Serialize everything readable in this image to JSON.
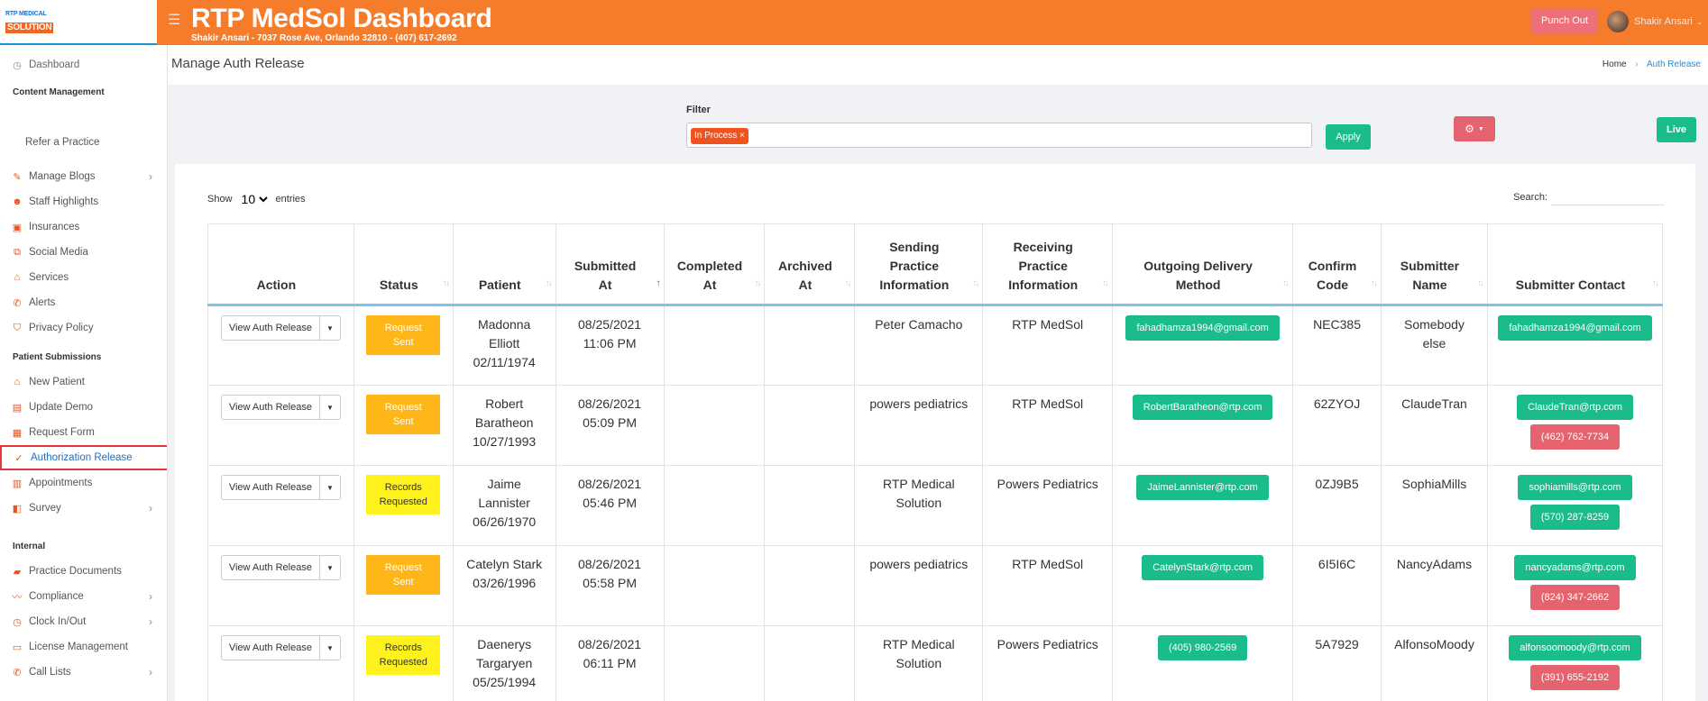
{
  "app": {
    "logo_line1": "RTP MEDICAL",
    "logo_line2": "SOLUTION",
    "title": "RTP MedSol Dashboard",
    "subtitle": "Shakir Ansari - 7037 Rose Ave, Orlando 32810 - (407) 617-2692",
    "punch_out": "Punch Out",
    "user_name": "Shakir Ansari"
  },
  "sidebar": {
    "dashboard": "Dashboard",
    "section_content": "Content Management",
    "refer": "Refer a Practice",
    "manage_blogs": "Manage Blogs",
    "staff_highlights": "Staff Highlights",
    "insurances": "Insurances",
    "social_media": "Social Media",
    "services": "Services",
    "alerts": "Alerts",
    "privacy_policy": "Privacy Policy",
    "section_patient": "Patient Submissions",
    "new_patient": "New Patient",
    "update_demo": "Update Demo",
    "request_form": "Request Form",
    "authorization_release": "Authorization Release",
    "appointments": "Appointments",
    "survey": "Survey",
    "section_internal": "Internal",
    "practice_documents": "Practice Documents",
    "compliance": "Compliance",
    "clock": "Clock In/Out",
    "license": "License Management",
    "call_lists": "Call Lists"
  },
  "page": {
    "title": "Manage Auth Release",
    "breadcrumb_home": "Home",
    "breadcrumb_current": "Auth Release"
  },
  "filter": {
    "label": "Filter",
    "chip": "In Process",
    "apply": "Apply",
    "live": "Live"
  },
  "table_controls": {
    "show": "Show",
    "entries_value": "10",
    "entries": "entries",
    "search": "Search:"
  },
  "columns": {
    "action": "Action",
    "status": "Status",
    "patient": "Patient",
    "submitted_1": "Submitted",
    "submitted_2": "At",
    "completed_1": "Completed",
    "completed_2": "At",
    "archived_1": "Archived",
    "archived_2": "At",
    "sending_1": "Sending",
    "sending_2": "Practice",
    "sending_3": "Information",
    "receiving_1": "Receiving",
    "receiving_2": "Practice",
    "receiving_3": "Information",
    "delivery_1": "Outgoing Delivery",
    "delivery_2": "Method",
    "confirm_1": "Confirm",
    "confirm_2": "Code",
    "submitter_1": "Submitter",
    "submitter_2": "Name",
    "contact": "Submitter Contact"
  },
  "action_label": "View Auth Release",
  "rows": [
    {
      "status_1": "Request",
      "status_2": "Sent",
      "patient_1": "Madonna",
      "patient_2": "Elliott",
      "patient_3": "02/11/1974",
      "submitted_1": "08/25/2021",
      "submitted_2": "11:06 PM",
      "sending_1": "Peter Camacho",
      "sending_2": "",
      "receiving": "RTP MedSol",
      "delivery": "fahadhamza1994@gmail.com",
      "code": "NEC385",
      "submitter_1": "Somebody",
      "submitter_2": "else",
      "contact_email": "fahadhamza1994@gmail.com",
      "contact_phone": ""
    },
    {
      "status_1": "Request",
      "status_2": "Sent",
      "patient_1": "Robert",
      "patient_2": "Baratheon",
      "patient_3": "10/27/1993",
      "submitted_1": "08/26/2021",
      "submitted_2": "05:09 PM",
      "sending_1": "powers pediatrics",
      "sending_2": "",
      "receiving": "RTP MedSol",
      "delivery": "RobertBaratheon@rtp.com",
      "code": "62ZYOJ",
      "submitter_1": "ClaudeTran",
      "submitter_2": "",
      "contact_email": "ClaudeTran@rtp.com",
      "contact_phone": "(462) 762-7734"
    },
    {
      "status_1": "Records",
      "status_2": "Requested",
      "patient_1": "Jaime",
      "patient_2": "Lannister",
      "patient_3": "06/26/1970",
      "submitted_1": "08/26/2021",
      "submitted_2": "05:46 PM",
      "sending_1": "RTP Medical",
      "sending_2": "Solution",
      "receiving": "Powers Pediatrics",
      "delivery": "JaimeLannister@rtp.com",
      "code": "0ZJ9B5",
      "submitter_1": "SophiaMills",
      "submitter_2": "",
      "contact_email": "sophiamills@rtp.com",
      "contact_phone": "(570) 287-8259"
    },
    {
      "status_1": "Request",
      "status_2": "Sent",
      "patient_1": "Catelyn Stark",
      "patient_2": "03/26/1996",
      "patient_3": "",
      "submitted_1": "08/26/2021",
      "submitted_2": "05:58 PM",
      "sending_1": "powers pediatrics",
      "sending_2": "",
      "receiving": "RTP MedSol",
      "delivery": "CatelynStark@rtp.com",
      "code": "6I5I6C",
      "submitter_1": "NancyAdams",
      "submitter_2": "",
      "contact_email": "nancyadams@rtp.com",
      "contact_phone": "(824) 347-2662"
    },
    {
      "status_1": "Records",
      "status_2": "Requested",
      "patient_1": "Daenerys",
      "patient_2": "Targaryen",
      "patient_3": "05/25/1994",
      "submitted_1": "08/26/2021",
      "submitted_2": "06:11 PM",
      "sending_1": "RTP Medical",
      "sending_2": "Solution",
      "receiving": "Powers Pediatrics",
      "delivery": "(405) 980-2569",
      "code": "5A7929",
      "submitter_1": "AlfonsoMoody",
      "submitter_2": "",
      "contact_email": "alfonsoomoody@rtp.com",
      "contact_phone": "(391) 655-2192"
    }
  ],
  "colors": {
    "header": "#f57c2a",
    "accent_green": "#1abc8c",
    "accent_red": "#e4636e",
    "status_orange": "#ffb619",
    "status_yellow": "#fff21c"
  }
}
